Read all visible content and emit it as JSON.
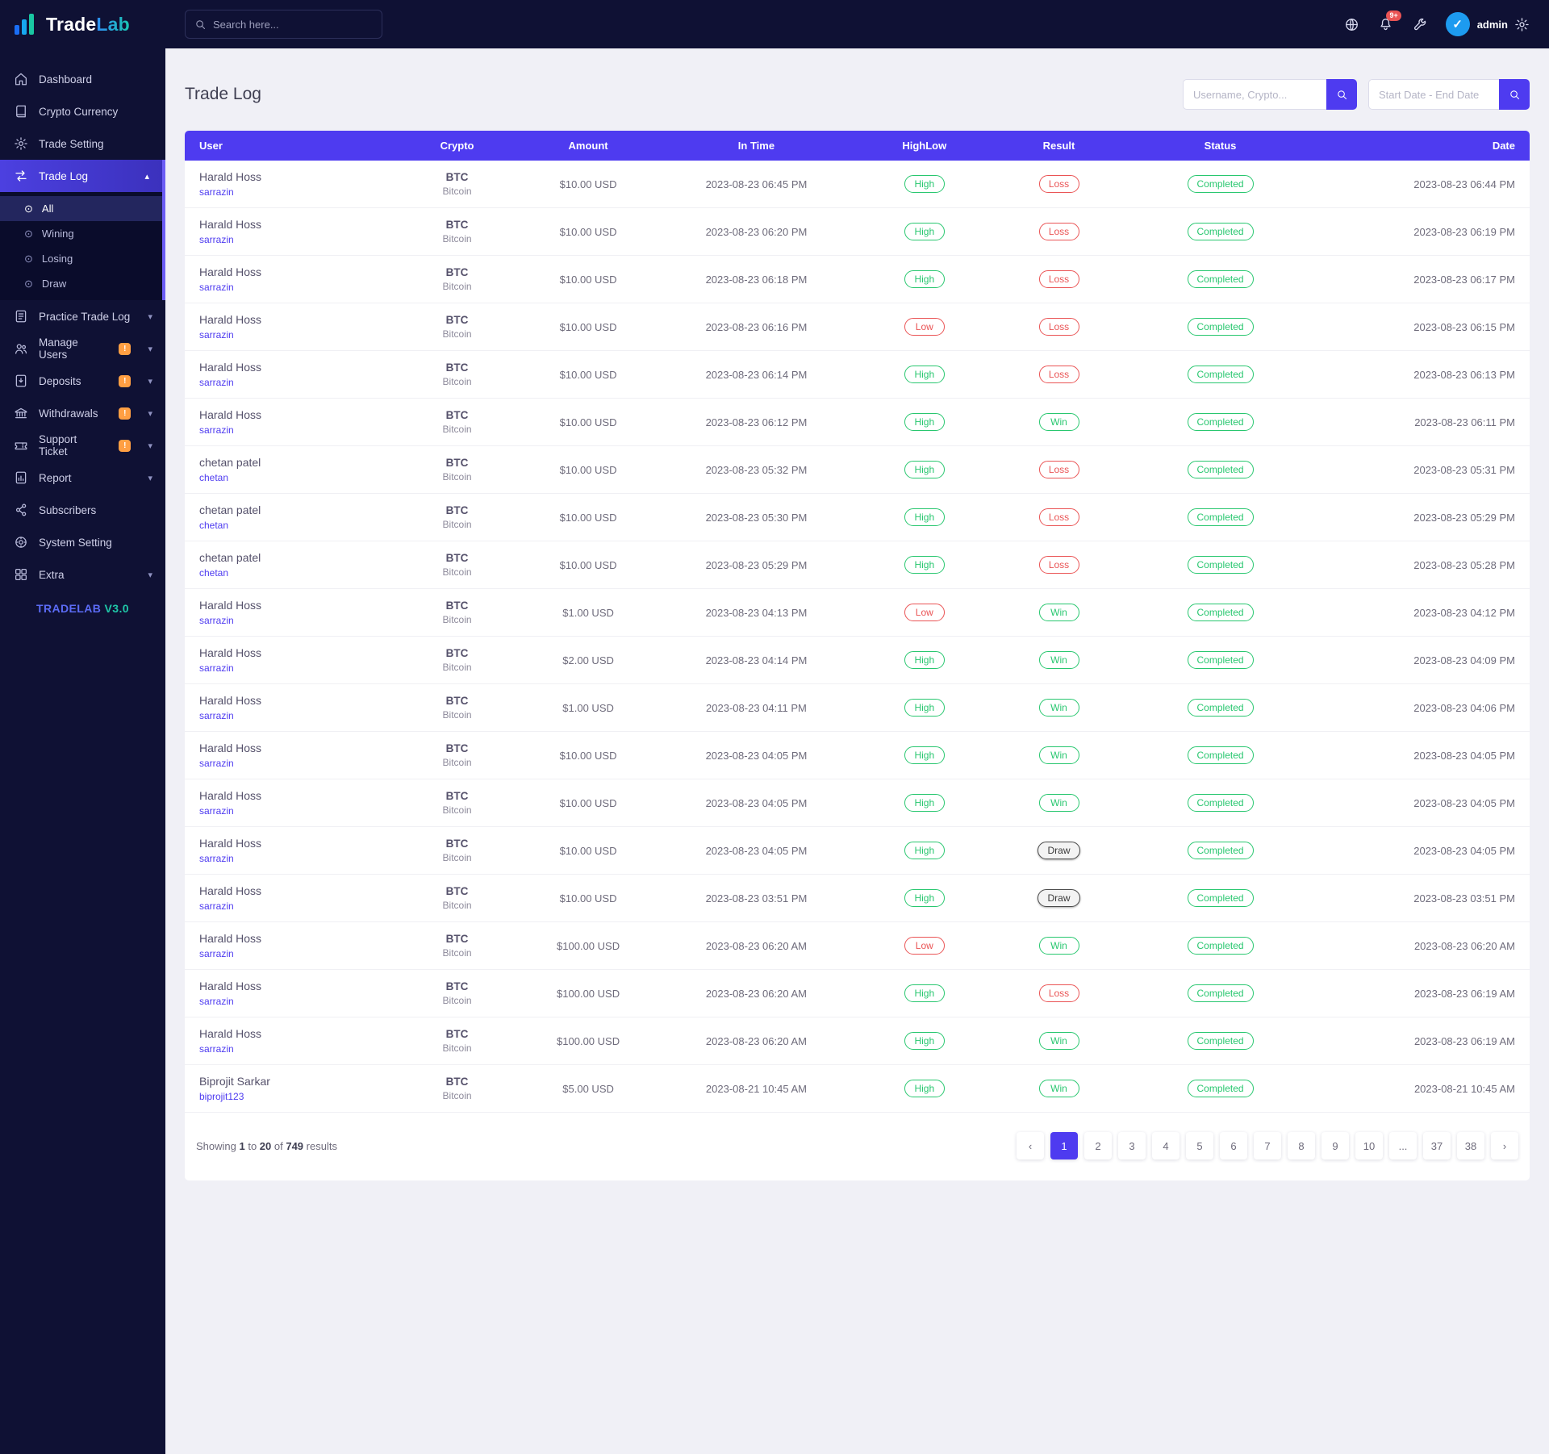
{
  "brand": {
    "name_a": "Trade",
    "name_b": "Lab",
    "version_name": "TRADELAB",
    "version_number": "V3.0"
  },
  "topbar": {
    "search_placeholder": "Search here...",
    "notification_count": "9+",
    "username": "admin",
    "avatar_glyph": "✓"
  },
  "sidebar": {
    "items": [
      {
        "label": "Dashboard",
        "icon": "home"
      },
      {
        "label": "Crypto Currency",
        "icon": "book"
      },
      {
        "label": "Trade Setting",
        "icon": "gear"
      },
      {
        "label": "Trade Log",
        "icon": "trade",
        "active": true,
        "expanded": true,
        "children": [
          {
            "label": "All",
            "active": true
          },
          {
            "label": "Wining"
          },
          {
            "label": "Losing"
          },
          {
            "label": "Draw"
          }
        ]
      },
      {
        "label": "Practice Trade Log",
        "icon": "practice",
        "chevron": true
      },
      {
        "label": "Manage Users",
        "icon": "users",
        "badge": "!",
        "chevron": true
      },
      {
        "label": "Deposits",
        "icon": "deposit",
        "badge": "!",
        "chevron": true
      },
      {
        "label": "Withdrawals",
        "icon": "bank",
        "badge": "!",
        "chevron": true
      },
      {
        "label": "Support Ticket",
        "icon": "ticket",
        "badge": "!",
        "chevron": true
      },
      {
        "label": "Report",
        "icon": "report",
        "chevron": true
      },
      {
        "label": "Subscribers",
        "icon": "subscribers"
      },
      {
        "label": "System Setting",
        "icon": "system"
      },
      {
        "label": "Extra",
        "icon": "extra",
        "chevron": true
      }
    ]
  },
  "page": {
    "title": "Trade Log"
  },
  "filters": {
    "username_placeholder": "Username, Crypto...",
    "date_placeholder": "Start Date - End Date"
  },
  "table": {
    "headers": [
      "User",
      "Crypto",
      "Amount",
      "In Time",
      "HighLow",
      "Result",
      "Status",
      "Date"
    ],
    "rows": [
      {
        "user": "Harald Hoss",
        "username": "sarrazin",
        "crypto": "BTC",
        "crypto_name": "Bitcoin",
        "amount": "$10.00 USD",
        "in_time": "2023-08-23 06:45 PM",
        "highlow": "High",
        "result": "Loss",
        "status": "Completed",
        "date": "2023-08-23 06:44 PM"
      },
      {
        "user": "Harald Hoss",
        "username": "sarrazin",
        "crypto": "BTC",
        "crypto_name": "Bitcoin",
        "amount": "$10.00 USD",
        "in_time": "2023-08-23 06:20 PM",
        "highlow": "High",
        "result": "Loss",
        "status": "Completed",
        "date": "2023-08-23 06:19 PM"
      },
      {
        "user": "Harald Hoss",
        "username": "sarrazin",
        "crypto": "BTC",
        "crypto_name": "Bitcoin",
        "amount": "$10.00 USD",
        "in_time": "2023-08-23 06:18 PM",
        "highlow": "High",
        "result": "Loss",
        "status": "Completed",
        "date": "2023-08-23 06:17 PM"
      },
      {
        "user": "Harald Hoss",
        "username": "sarrazin",
        "crypto": "BTC",
        "crypto_name": "Bitcoin",
        "amount": "$10.00 USD",
        "in_time": "2023-08-23 06:16 PM",
        "highlow": "Low",
        "result": "Loss",
        "status": "Completed",
        "date": "2023-08-23 06:15 PM"
      },
      {
        "user": "Harald Hoss",
        "username": "sarrazin",
        "crypto": "BTC",
        "crypto_name": "Bitcoin",
        "amount": "$10.00 USD",
        "in_time": "2023-08-23 06:14 PM",
        "highlow": "High",
        "result": "Loss",
        "status": "Completed",
        "date": "2023-08-23 06:13 PM"
      },
      {
        "user": "Harald Hoss",
        "username": "sarrazin",
        "crypto": "BTC",
        "crypto_name": "Bitcoin",
        "amount": "$10.00 USD",
        "in_time": "2023-08-23 06:12 PM",
        "highlow": "High",
        "result": "Win",
        "status": "Completed",
        "date": "2023-08-23 06:11 PM"
      },
      {
        "user": "chetan patel",
        "username": "chetan",
        "crypto": "BTC",
        "crypto_name": "Bitcoin",
        "amount": "$10.00 USD",
        "in_time": "2023-08-23 05:32 PM",
        "highlow": "High",
        "result": "Loss",
        "status": "Completed",
        "date": "2023-08-23 05:31 PM"
      },
      {
        "user": "chetan patel",
        "username": "chetan",
        "crypto": "BTC",
        "crypto_name": "Bitcoin",
        "amount": "$10.00 USD",
        "in_time": "2023-08-23 05:30 PM",
        "highlow": "High",
        "result": "Loss",
        "status": "Completed",
        "date": "2023-08-23 05:29 PM"
      },
      {
        "user": "chetan patel",
        "username": "chetan",
        "crypto": "BTC",
        "crypto_name": "Bitcoin",
        "amount": "$10.00 USD",
        "in_time": "2023-08-23 05:29 PM",
        "highlow": "High",
        "result": "Loss",
        "status": "Completed",
        "date": "2023-08-23 05:28 PM"
      },
      {
        "user": "Harald Hoss",
        "username": "sarrazin",
        "crypto": "BTC",
        "crypto_name": "Bitcoin",
        "amount": "$1.00 USD",
        "in_time": "2023-08-23 04:13 PM",
        "highlow": "Low",
        "result": "Win",
        "status": "Completed",
        "date": "2023-08-23 04:12 PM"
      },
      {
        "user": "Harald Hoss",
        "username": "sarrazin",
        "crypto": "BTC",
        "crypto_name": "Bitcoin",
        "amount": "$2.00 USD",
        "in_time": "2023-08-23 04:14 PM",
        "highlow": "High",
        "result": "Win",
        "status": "Completed",
        "date": "2023-08-23 04:09 PM"
      },
      {
        "user": "Harald Hoss",
        "username": "sarrazin",
        "crypto": "BTC",
        "crypto_name": "Bitcoin",
        "amount": "$1.00 USD",
        "in_time": "2023-08-23 04:11 PM",
        "highlow": "High",
        "result": "Win",
        "status": "Completed",
        "date": "2023-08-23 04:06 PM"
      },
      {
        "user": "Harald Hoss",
        "username": "sarrazin",
        "crypto": "BTC",
        "crypto_name": "Bitcoin",
        "amount": "$10.00 USD",
        "in_time": "2023-08-23 04:05 PM",
        "highlow": "High",
        "result": "Win",
        "status": "Completed",
        "date": "2023-08-23 04:05 PM"
      },
      {
        "user": "Harald Hoss",
        "username": "sarrazin",
        "crypto": "BTC",
        "crypto_name": "Bitcoin",
        "amount": "$10.00 USD",
        "in_time": "2023-08-23 04:05 PM",
        "highlow": "High",
        "result": "Win",
        "status": "Completed",
        "date": "2023-08-23 04:05 PM"
      },
      {
        "user": "Harald Hoss",
        "username": "sarrazin",
        "crypto": "BTC",
        "crypto_name": "Bitcoin",
        "amount": "$10.00 USD",
        "in_time": "2023-08-23 04:05 PM",
        "highlow": "High",
        "result": "Draw",
        "status": "Completed",
        "date": "2023-08-23 04:05 PM"
      },
      {
        "user": "Harald Hoss",
        "username": "sarrazin",
        "crypto": "BTC",
        "crypto_name": "Bitcoin",
        "amount": "$10.00 USD",
        "in_time": "2023-08-23 03:51 PM",
        "highlow": "High",
        "result": "Draw",
        "status": "Completed",
        "date": "2023-08-23 03:51 PM"
      },
      {
        "user": "Harald Hoss",
        "username": "sarrazin",
        "crypto": "BTC",
        "crypto_name": "Bitcoin",
        "amount": "$100.00 USD",
        "in_time": "2023-08-23 06:20 AM",
        "highlow": "Low",
        "result": "Win",
        "status": "Completed",
        "date": "2023-08-23 06:20 AM"
      },
      {
        "user": "Harald Hoss",
        "username": "sarrazin",
        "crypto": "BTC",
        "crypto_name": "Bitcoin",
        "amount": "$100.00 USD",
        "in_time": "2023-08-23 06:20 AM",
        "highlow": "High",
        "result": "Loss",
        "status": "Completed",
        "date": "2023-08-23 06:19 AM"
      },
      {
        "user": "Harald Hoss",
        "username": "sarrazin",
        "crypto": "BTC",
        "crypto_name": "Bitcoin",
        "amount": "$100.00 USD",
        "in_time": "2023-08-23 06:20 AM",
        "highlow": "High",
        "result": "Win",
        "status": "Completed",
        "date": "2023-08-23 06:19 AM"
      },
      {
        "user": "Biprojit Sarkar",
        "username": "biprojit123",
        "crypto": "BTC",
        "crypto_name": "Bitcoin",
        "amount": "$5.00 USD",
        "in_time": "2023-08-21 10:45 AM",
        "highlow": "High",
        "result": "Win",
        "status": "Completed",
        "date": "2023-08-21 10:45 AM"
      }
    ]
  },
  "pagination": {
    "showing_text": "Showing",
    "from": "1",
    "to_text": "to",
    "to": "20",
    "of_text": "of",
    "total": "749",
    "results_text": "results",
    "pages": [
      "‹",
      "1",
      "2",
      "3",
      "4",
      "5",
      "6",
      "7",
      "8",
      "9",
      "10",
      "...",
      "37",
      "38",
      "›"
    ],
    "active": "1"
  },
  "colors": {
    "accent": "#4e3bf0",
    "green": "#28c76f",
    "red": "#ea5455",
    "orange": "#ff9f43",
    "sidebar_bg": "#0f1134"
  }
}
